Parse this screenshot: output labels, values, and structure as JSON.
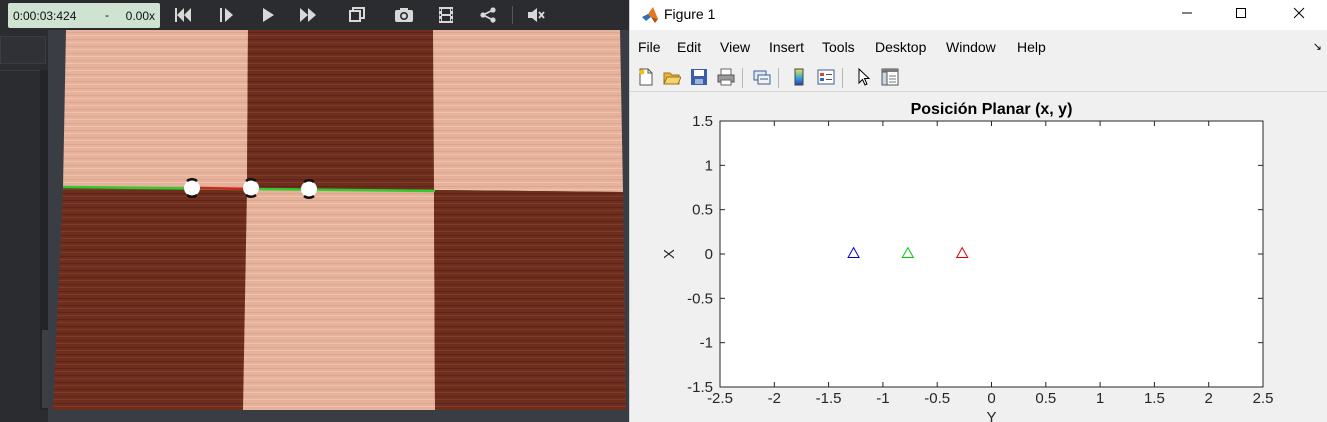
{
  "player": {
    "time": "0:00:03:424",
    "separator": "-",
    "rate": "0.00x",
    "buttons": [
      "skip-back",
      "step-forward",
      "play",
      "fast-forward",
      "crop",
      "snapshot",
      "film",
      "share",
      "mute"
    ]
  },
  "video": {
    "board_colors": {
      "light": "#e6b29c",
      "dark": "#6e2e1e"
    },
    "line_colors": {
      "green": "#2ecc2e",
      "red": "#d42020"
    },
    "markers": 3
  },
  "figure": {
    "window_title": "Figure 1",
    "menu": [
      "File",
      "Edit",
      "View",
      "Insert",
      "Tools",
      "Desktop",
      "Window",
      "Help"
    ],
    "toolbar_icons": [
      "new-figure-icon",
      "open-file-icon",
      "save-icon",
      "print-icon",
      "link-icon",
      "colorbar-icon",
      "legend-icon",
      "select-cursor-icon",
      "property-inspector-icon"
    ]
  },
  "chart_data": {
    "type": "scatter",
    "title": "Posición Planar (x, y)",
    "xlabel": "Y",
    "ylabel": "X",
    "xlim": [
      -2.5,
      2.5
    ],
    "ylim": [
      -1.5,
      1.5
    ],
    "xticks": [
      "-2.5",
      "-2",
      "-1.5",
      "-1",
      "-0.5",
      "0",
      "0.5",
      "1",
      "1.5",
      "2",
      "2.5"
    ],
    "yticks": [
      "1.5",
      "1",
      "0.5",
      "0",
      "-0.5",
      "-1",
      "-1.5"
    ],
    "marker": "triangle",
    "series": [
      {
        "color": "#0000cc",
        "x": -1.27,
        "y": 0.01
      },
      {
        "color": "#00cc00",
        "x": -0.77,
        "y": 0.01
      },
      {
        "color": "#dd0000",
        "x": -0.27,
        "y": 0.01
      }
    ]
  }
}
